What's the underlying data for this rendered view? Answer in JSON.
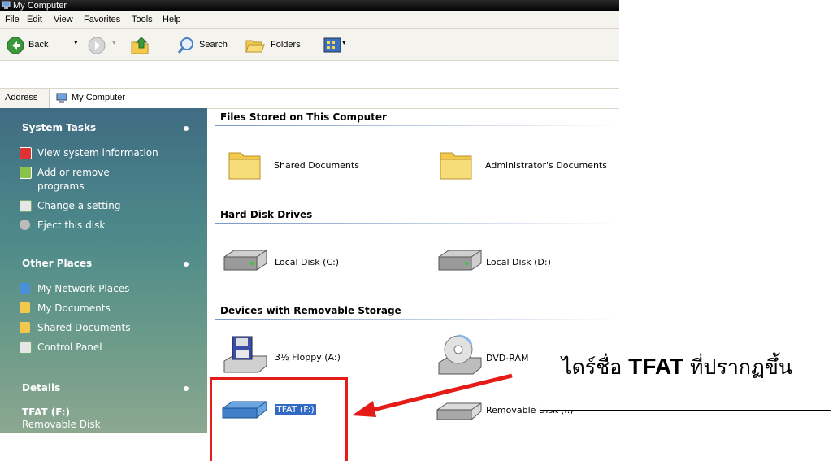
{
  "window": {
    "title": "My Computer"
  },
  "menu": [
    "File",
    "Edit",
    "View",
    "Favorites",
    "Tools",
    "Help"
  ],
  "toolbar": {
    "back_label": "Back",
    "search_label": "Search",
    "folders_label": "Folders"
  },
  "address": {
    "label": "Address",
    "value": "My Computer"
  },
  "task_pane": {
    "system_tasks": {
      "title": "System Tasks",
      "items": [
        "View system information",
        "Add or remove",
        "programs",
        "Change a setting",
        "Eject this disk"
      ]
    },
    "other_places": {
      "title": "Other Places",
      "items": [
        "My Network Places",
        "My Documents",
        "Shared Documents",
        "Control Panel"
      ]
    },
    "details": {
      "title": "Details",
      "name": "TFAT (F:)",
      "type": "Removable Disk"
    }
  },
  "groups": {
    "files": {
      "title": "Files Stored on This Computer",
      "items": [
        "Shared Documents",
        "Administrator's Documents"
      ]
    },
    "hdd": {
      "title": "Hard Disk Drives",
      "items": [
        "Local Disk (C:)",
        "Local Disk (D:)"
      ]
    },
    "removable": {
      "title": "Devices with Removable Storage",
      "items": [
        "3½ Floppy (A:)",
        "DVD-RAM",
        "TFAT (F:)",
        "Removable Disk (I:)"
      ]
    }
  },
  "callout": {
    "prefix": "ไดร์ชื่อ ",
    "name": "TFAT",
    "suffix": " ที่ปรากฏขึ้น"
  },
  "colors": {
    "annotation": "#e41b17",
    "selection": "#316ac5",
    "task_pane": "#3f6c83"
  }
}
